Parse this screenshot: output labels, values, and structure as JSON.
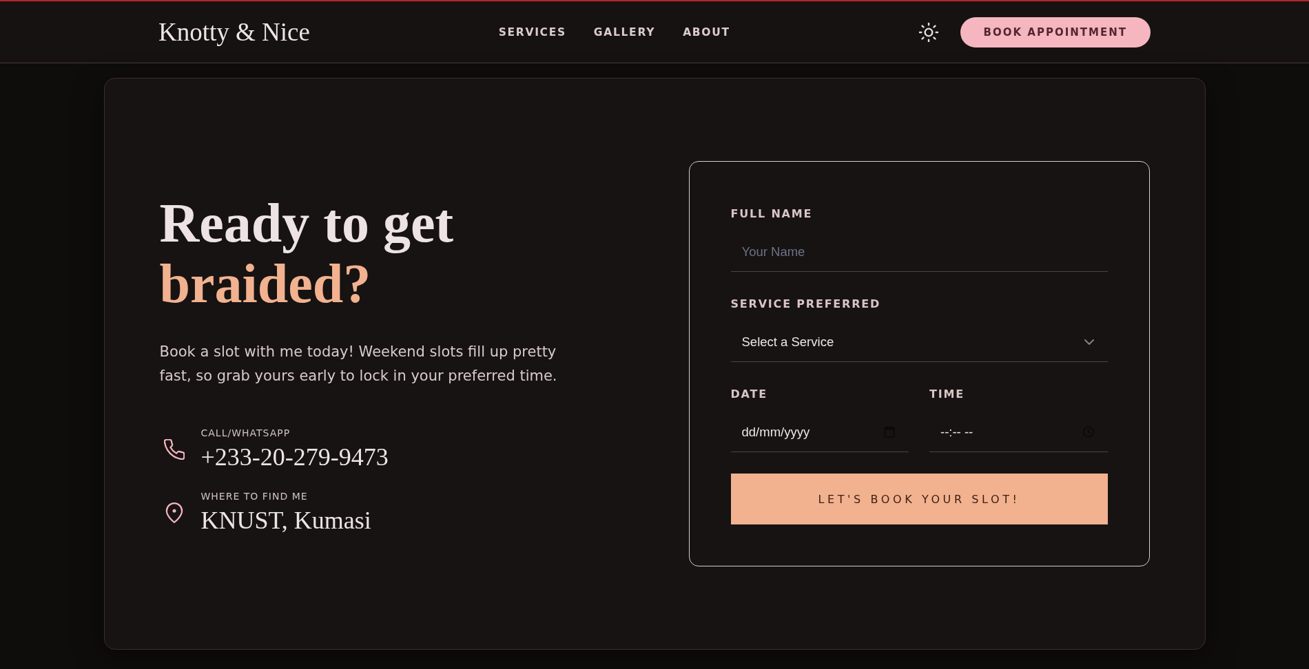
{
  "header": {
    "logo": "Knotty & Nice",
    "nav": [
      "SERVICES",
      "GALLERY",
      "ABOUT"
    ],
    "cta": "BOOK APPOINTMENT"
  },
  "hero": {
    "heading": {
      "text": "Ready to get",
      "accent": "braided?"
    },
    "description": "Book a slot with me today! Weekend slots fill up pretty fast, so grab yours early to lock in your preferred time.",
    "contacts": [
      {
        "kind": "phone",
        "label": "CALL/WHATSAPP",
        "value": "+233-20-279-9473"
      },
      {
        "kind": "location",
        "label": "WHERE TO FIND ME",
        "value": "KNUST, Kumasi"
      }
    ]
  },
  "booking_form": {
    "fields": [
      {
        "kind": "text",
        "label": "FULL NAME",
        "placeholder": "Your Name"
      },
      {
        "kind": "select",
        "label": "SERVICE PREFERRED",
        "value": "Select a Service"
      }
    ],
    "row_fields": [
      {
        "kind": "date",
        "label": "DATE",
        "value": "dd/mm/yyyy"
      },
      {
        "kind": "time",
        "label": "TIME",
        "value": "--:-- --"
      }
    ],
    "submit": "LET'S BOOK YOUR SLOT!"
  }
}
